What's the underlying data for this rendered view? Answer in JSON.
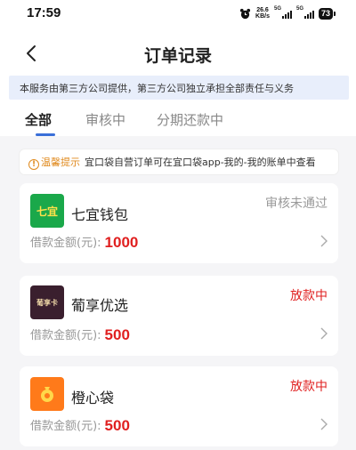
{
  "status_bar": {
    "time": "17:59",
    "speed_value": "26.6",
    "speed_unit": "KB/s",
    "signal1_label": "5G",
    "signal2_label": "5G",
    "battery": "73"
  },
  "header": {
    "title": "订单记录"
  },
  "notice": "本服务由第三方公司提供，第三方公司独立承担全部责任与义务",
  "tabs": [
    {
      "label": "全部"
    },
    {
      "label": "审核中"
    },
    {
      "label": "分期还款中"
    }
  ],
  "tip": {
    "label": "温馨提示",
    "text": "宜口袋自营订单可在宜口袋app-我的-我的账单中查看"
  },
  "orders": [
    {
      "name": "七宜钱包",
      "logo_text": "七宜",
      "status": "审核未通过",
      "status_color": "#999999",
      "amount_label": "借款金额(元):",
      "amount": "1000"
    },
    {
      "name": "葡享优选",
      "logo_text": "葡享卡",
      "status": "放款中",
      "status_color": "#e02020",
      "amount_label": "借款金额(元):",
      "amount": "500"
    },
    {
      "name": "橙心袋",
      "logo_text": "",
      "status": "放款中",
      "status_color": "#e02020",
      "amount_label": "借款金额(元):",
      "amount": "500"
    }
  ],
  "colors": {
    "accent": "#3a6fd8",
    "amount": "#e02020",
    "tip": "#e08a1e"
  }
}
